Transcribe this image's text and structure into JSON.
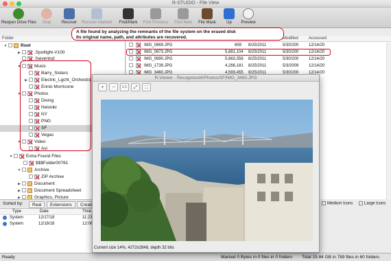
{
  "window": {
    "title": "R-STUDIO - File View"
  },
  "toolbar": [
    {
      "label": "Reopen Drive Files",
      "icon": "refresh-icon",
      "enabled": true,
      "color": "#3d8a2f"
    },
    {
      "label": "Stop",
      "icon": "stop-icon",
      "enabled": false,
      "color": "#c95b3a"
    },
    {
      "label": "Recover",
      "icon": "recover-icon",
      "enabled": true,
      "color": "#4b6fa8"
    },
    {
      "label": "Recover Marked",
      "icon": "recover-marked-icon",
      "enabled": false,
      "color": "#7d8fb0"
    },
    {
      "label": "Find/Mark",
      "icon": "binoculars-icon",
      "enabled": true,
      "color": "#333333"
    },
    {
      "label": "Find Previous",
      "icon": "find-previous-icon",
      "enabled": false,
      "color": "#555555"
    },
    {
      "label": "Find Next",
      "icon": "find-next-icon",
      "enabled": false,
      "color": "#555555"
    },
    {
      "label": "File Mask",
      "icon": "mask-icon",
      "enabled": true,
      "color": "#6b4a2f"
    },
    {
      "label": "Up",
      "icon": "folder-up-icon",
      "enabled": true,
      "color": "#2f6fd0"
    },
    {
      "label": "Preview",
      "icon": "magnifier-icon",
      "enabled": true,
      "color": "#444444"
    }
  ],
  "callout": {
    "line1": "A file found by analyzing the remnants of the file system on the erased disk",
    "line2": "Its original name, path, and attributes are recovered."
  },
  "folder_panel": {
    "header": "Folder",
    "rows": [
      {
        "label": "Root",
        "bold": true
      },
      {
        "label": ".Spotlight-V100"
      },
      {
        "label": ".fseventsd"
      },
      {
        "label": "Music"
      },
      {
        "label": "Barry_Sisters"
      },
      {
        "label": "Electric_Lgcht_Orchestra"
      },
      {
        "label": "Ennio Morricone"
      },
      {
        "label": "Photos"
      },
      {
        "label": "Diving"
      },
      {
        "label": "Helsinki"
      },
      {
        "label": "NY"
      },
      {
        "label": "PNG"
      },
      {
        "label": "SF"
      },
      {
        "label": "Vegas"
      },
      {
        "label": "Video"
      },
      {
        "label": "Avi"
      },
      {
        "label": "Extra Found Files"
      },
      {
        "label": "$$$Folder00761"
      },
      {
        "label": "Archive"
      },
      {
        "label": "ZIP Archive"
      },
      {
        "label": "Document"
      },
      {
        "label": "Document Spreadsheet"
      },
      {
        "label": "Graphics, Picture"
      }
    ]
  },
  "file_panel": {
    "columns": [
      "Modified",
      "Accessed"
    ],
    "rows": [
      {
        "name": "IMG_0869.JPG",
        "size": "659",
        "created": "8/25/2011",
        "modified": "5/30/200",
        "accessed": "12/14/20"
      },
      {
        "name": "IMG_0873.JPG",
        "size": "5,881,104",
        "created": "8/25/2011",
        "modified": "5/30/200",
        "accessed": "12/14/20"
      },
      {
        "name": "IMG_0890.JPG",
        "size": "5,663,358",
        "created": "8/25/2011",
        "modified": "5/30/200",
        "accessed": "12/14/20"
      },
      {
        "name": "IMG_1739.JPG",
        "size": "4,266,181",
        "created": "8/25/2011",
        "modified": "5/3/2009",
        "accessed": "12/14/20"
      },
      {
        "name": "IMG_3460.JPG",
        "size": "4,593,455",
        "created": "8/25/2011",
        "modified": "5/30/200",
        "accessed": "12/14/20"
      }
    ]
  },
  "sortbar": {
    "label": "Sorted by:",
    "tabs": [
      "Real",
      "Extensions",
      "Creati"
    ]
  },
  "view_options": [
    "Medium Icons",
    "Large Icons"
  ],
  "log": {
    "columns": [
      "Type",
      "Date",
      "Time"
    ],
    "rows": [
      {
        "type": "System",
        "date": "12/17/18",
        "time": "11:23 PM"
      },
      {
        "type": "System",
        "date": "12/18/18",
        "time": "12:06 AM"
      }
    ]
  },
  "viewer": {
    "title": "R-Viewer - Recognized4/Photos/SF/IMG_3460.JPG",
    "caption": "Current size 14%, 4272x2848, depth 32 bits"
  },
  "status": {
    "left": "Ready",
    "marked": "Marked 0 Bytes in 0 files in 0 folders",
    "total": "Total 15.84 GB in 789 files in 60 folders"
  },
  "colors": {
    "highlight": "#d0021b",
    "selection": "#d4d4d4"
  }
}
